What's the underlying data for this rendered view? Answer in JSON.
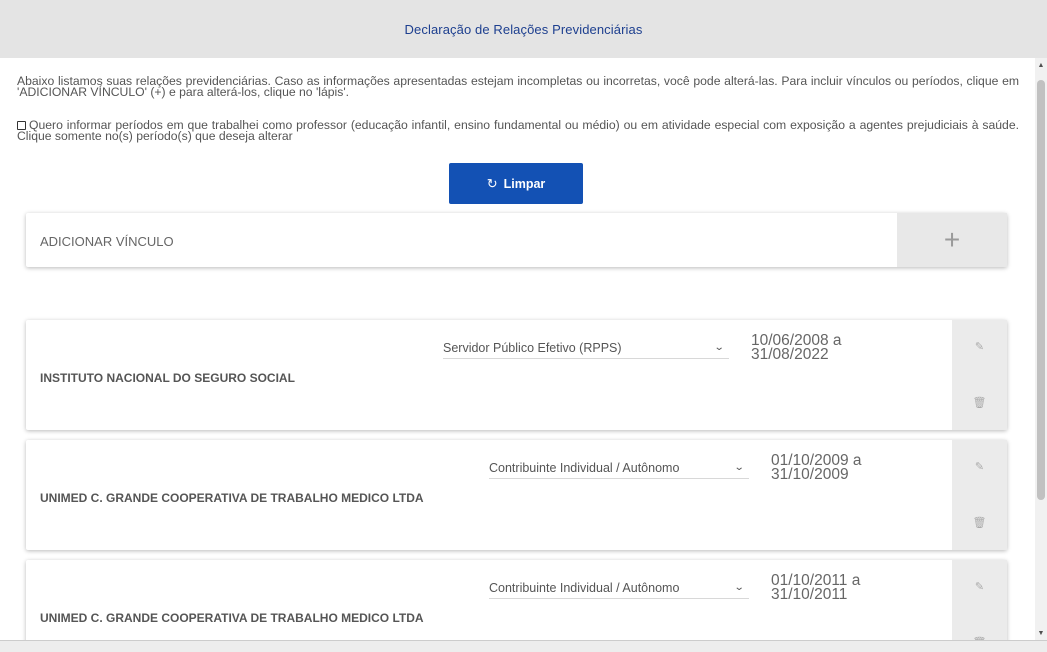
{
  "header": {
    "title": "Declaração de Relações Previdenciárias"
  },
  "intro": {
    "text": "Abaixo listamos suas relações previdenciárias. Caso as informações apresentadas estejam incompletas ou incorretas, você pode alterá-las. Para incluir vínculos ou períodos, clique em 'ADICIONAR VÍNCULO' (+) e para alterá-los, clique no 'lápis'."
  },
  "checkbox": {
    "label": "Quero informar períodos em que trabalhei como professor (educação infantil, ensino fundamental ou médio) ou em atividade especial com exposição a agentes prejudiciais à saúde. Clique somente no(s) período(s) que deseja alterar",
    "checked": false
  },
  "buttons": {
    "limpar": "Limpar",
    "limpar_icon": "refresh-icon"
  },
  "add_vinculo": {
    "label": "ADICIONAR VÍNCULO",
    "icon": "plus-icon"
  },
  "vinculos": [
    {
      "name": "INSTITUTO NACIONAL DO SEGURO SOCIAL",
      "type": "Servidor Público Efetivo (RPPS)",
      "start": "10/06/2008 a",
      "end": "31/08/2022"
    },
    {
      "name": "UNIMED C. GRANDE COOPERATIVA DE TRABALHO MEDICO LTDA",
      "type": "Contribuinte Individual / Autônomo",
      "start": "01/10/2009 a",
      "end": "31/10/2009"
    },
    {
      "name": "UNIMED C. GRANDE COOPERATIVA DE TRABALHO MEDICO LTDA",
      "type": "Contribuinte Individual / Autônomo",
      "start": "01/10/2011 a",
      "end": "31/10/2011"
    }
  ],
  "icons": {
    "edit": "pencil-icon",
    "delete": "trash-icon",
    "select": "chevron-down-icon"
  },
  "colors": {
    "primary_button": "#1351b4",
    "header_title": "#1d3f8f",
    "header_bg": "#e4e4e4"
  }
}
